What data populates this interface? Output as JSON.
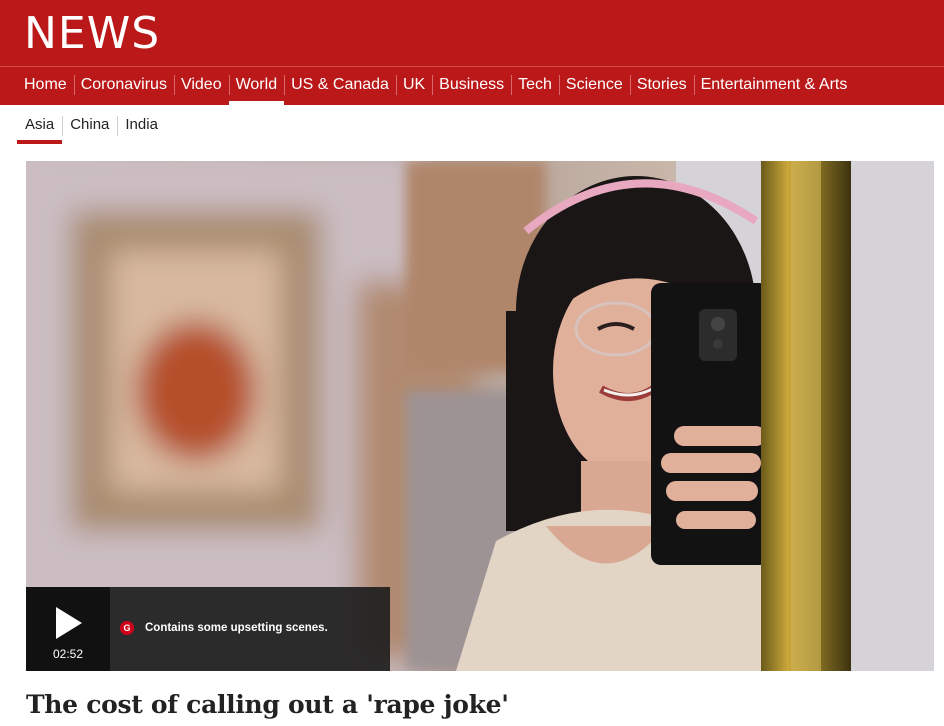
{
  "brand": {
    "logo_text": "NEWS",
    "accent_color": "#bb1919"
  },
  "nav": {
    "items": [
      {
        "label": "Home"
      },
      {
        "label": "Coronavirus"
      },
      {
        "label": "Video"
      },
      {
        "label": "World",
        "active": true
      },
      {
        "label": "US & Canada"
      },
      {
        "label": "UK"
      },
      {
        "label": "Business"
      },
      {
        "label": "Tech"
      },
      {
        "label": "Science"
      },
      {
        "label": "Stories"
      },
      {
        "label": "Entertainment & Arts"
      }
    ]
  },
  "subnav": {
    "items": [
      {
        "label": "Asia",
        "active": true
      },
      {
        "label": "China"
      },
      {
        "label": "India"
      }
    ]
  },
  "video": {
    "duration": "02:52",
    "guidance_icon": "G",
    "guidance_text": "Contains some upsetting scenes.",
    "icons": [
      "play-icon",
      "guidance-icon"
    ]
  },
  "article": {
    "headline": "The cost of calling out a 'rape joke'"
  }
}
